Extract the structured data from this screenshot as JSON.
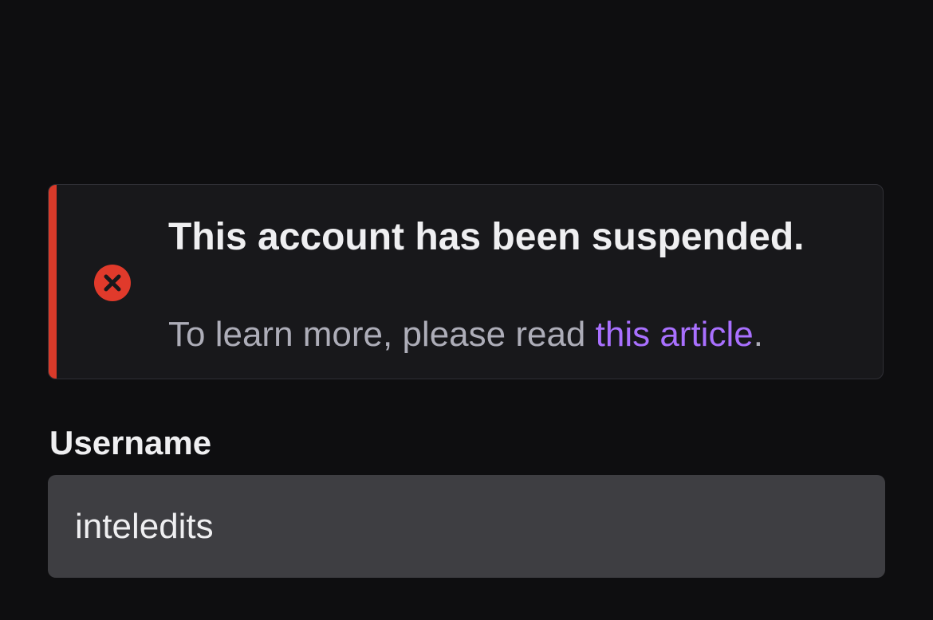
{
  "alert": {
    "icon": "error-x-circle-icon",
    "title": "This account has been suspended.",
    "body_prefix": "To learn more, please read ",
    "link_text": "this article",
    "body_suffix": ".",
    "accent_color": "#d93a2a",
    "link_color": "#a970ff"
  },
  "form": {
    "username_label": "Username",
    "username_value": "inteledits"
  }
}
